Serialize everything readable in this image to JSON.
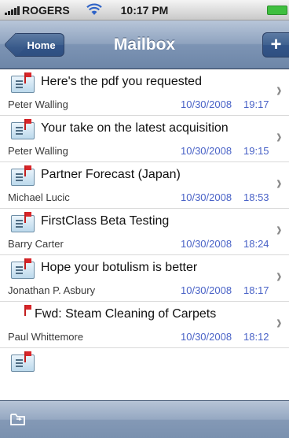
{
  "status_bar": {
    "carrier": "ROGERS",
    "time": "10:17 PM",
    "icons": [
      "signal-icon",
      "wifi-icon",
      "battery-icon"
    ]
  },
  "nav": {
    "back_label": "Home",
    "title": "Mailbox",
    "add_label": "+"
  },
  "messages": [
    {
      "subject": "Here's the pdf you requested",
      "sender": "Peter Walling",
      "date": "10/30/2008",
      "time": "19:17",
      "envelope": true
    },
    {
      "subject": "Your take on the latest acquisition",
      "sender": "Peter Walling",
      "date": "10/30/2008",
      "time": "19:15",
      "envelope": true
    },
    {
      "subject": "Partner Forecast (Japan)",
      "sender": "Michael Lucic",
      "date": "10/30/2008",
      "time": "18:53",
      "envelope": true
    },
    {
      "subject": "FirstClass Beta Testing",
      "sender": "Barry Carter",
      "date": "10/30/2008",
      "time": "18:24",
      "envelope": true
    },
    {
      "subject": "Hope your botulism is better",
      "sender": "Jonathan P. Asbury",
      "date": "10/30/2008",
      "time": "18:17",
      "envelope": true
    },
    {
      "subject": "Fwd: Steam Cleaning of Carpets",
      "sender": "Paul Whittemore",
      "date": "10/30/2008",
      "time": "18:12",
      "envelope": false
    }
  ],
  "colors": {
    "accent_date": "#4a63c7",
    "flag": "#d8262a",
    "nav_bar": "#7d94b4"
  },
  "toolbar": {
    "icons": [
      "folder-icon"
    ]
  }
}
